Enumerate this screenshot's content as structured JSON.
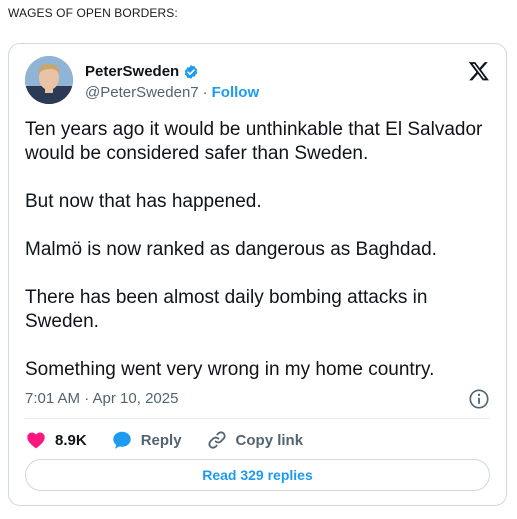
{
  "headline": "WAGES OF OPEN BORDERS:",
  "tweet": {
    "display_name": "PeterSweden",
    "handle": "@PeterSweden7",
    "separator": "·",
    "follow_label": "Follow",
    "verified": true,
    "paragraphs": [
      "Ten years ago it would be unthinkable that El Salvador would be considered safer than Sweden.",
      "But now that has happened.",
      "Malmö is now ranked as dangerous as Baghdad.",
      "There has been almost daily bombing attacks in Sweden.",
      "Something went very wrong in my home country."
    ],
    "timestamp": "7:01 AM · Apr 10, 2025",
    "likes_count": "8.9K",
    "reply_label": "Reply",
    "copy_link_label": "Copy link",
    "read_replies_label": "Read 329 replies"
  },
  "colors": {
    "accent": "#1d9bf0",
    "like": "#f91880",
    "text_primary": "#0f1419",
    "text_secondary": "#536471",
    "border": "#cfd9de"
  },
  "icons": {
    "verified": "verified-badge-icon",
    "platform": "x-logo-icon",
    "info": "info-icon",
    "like": "heart-icon",
    "reply": "speech-bubble-icon",
    "copy_link": "link-icon"
  }
}
